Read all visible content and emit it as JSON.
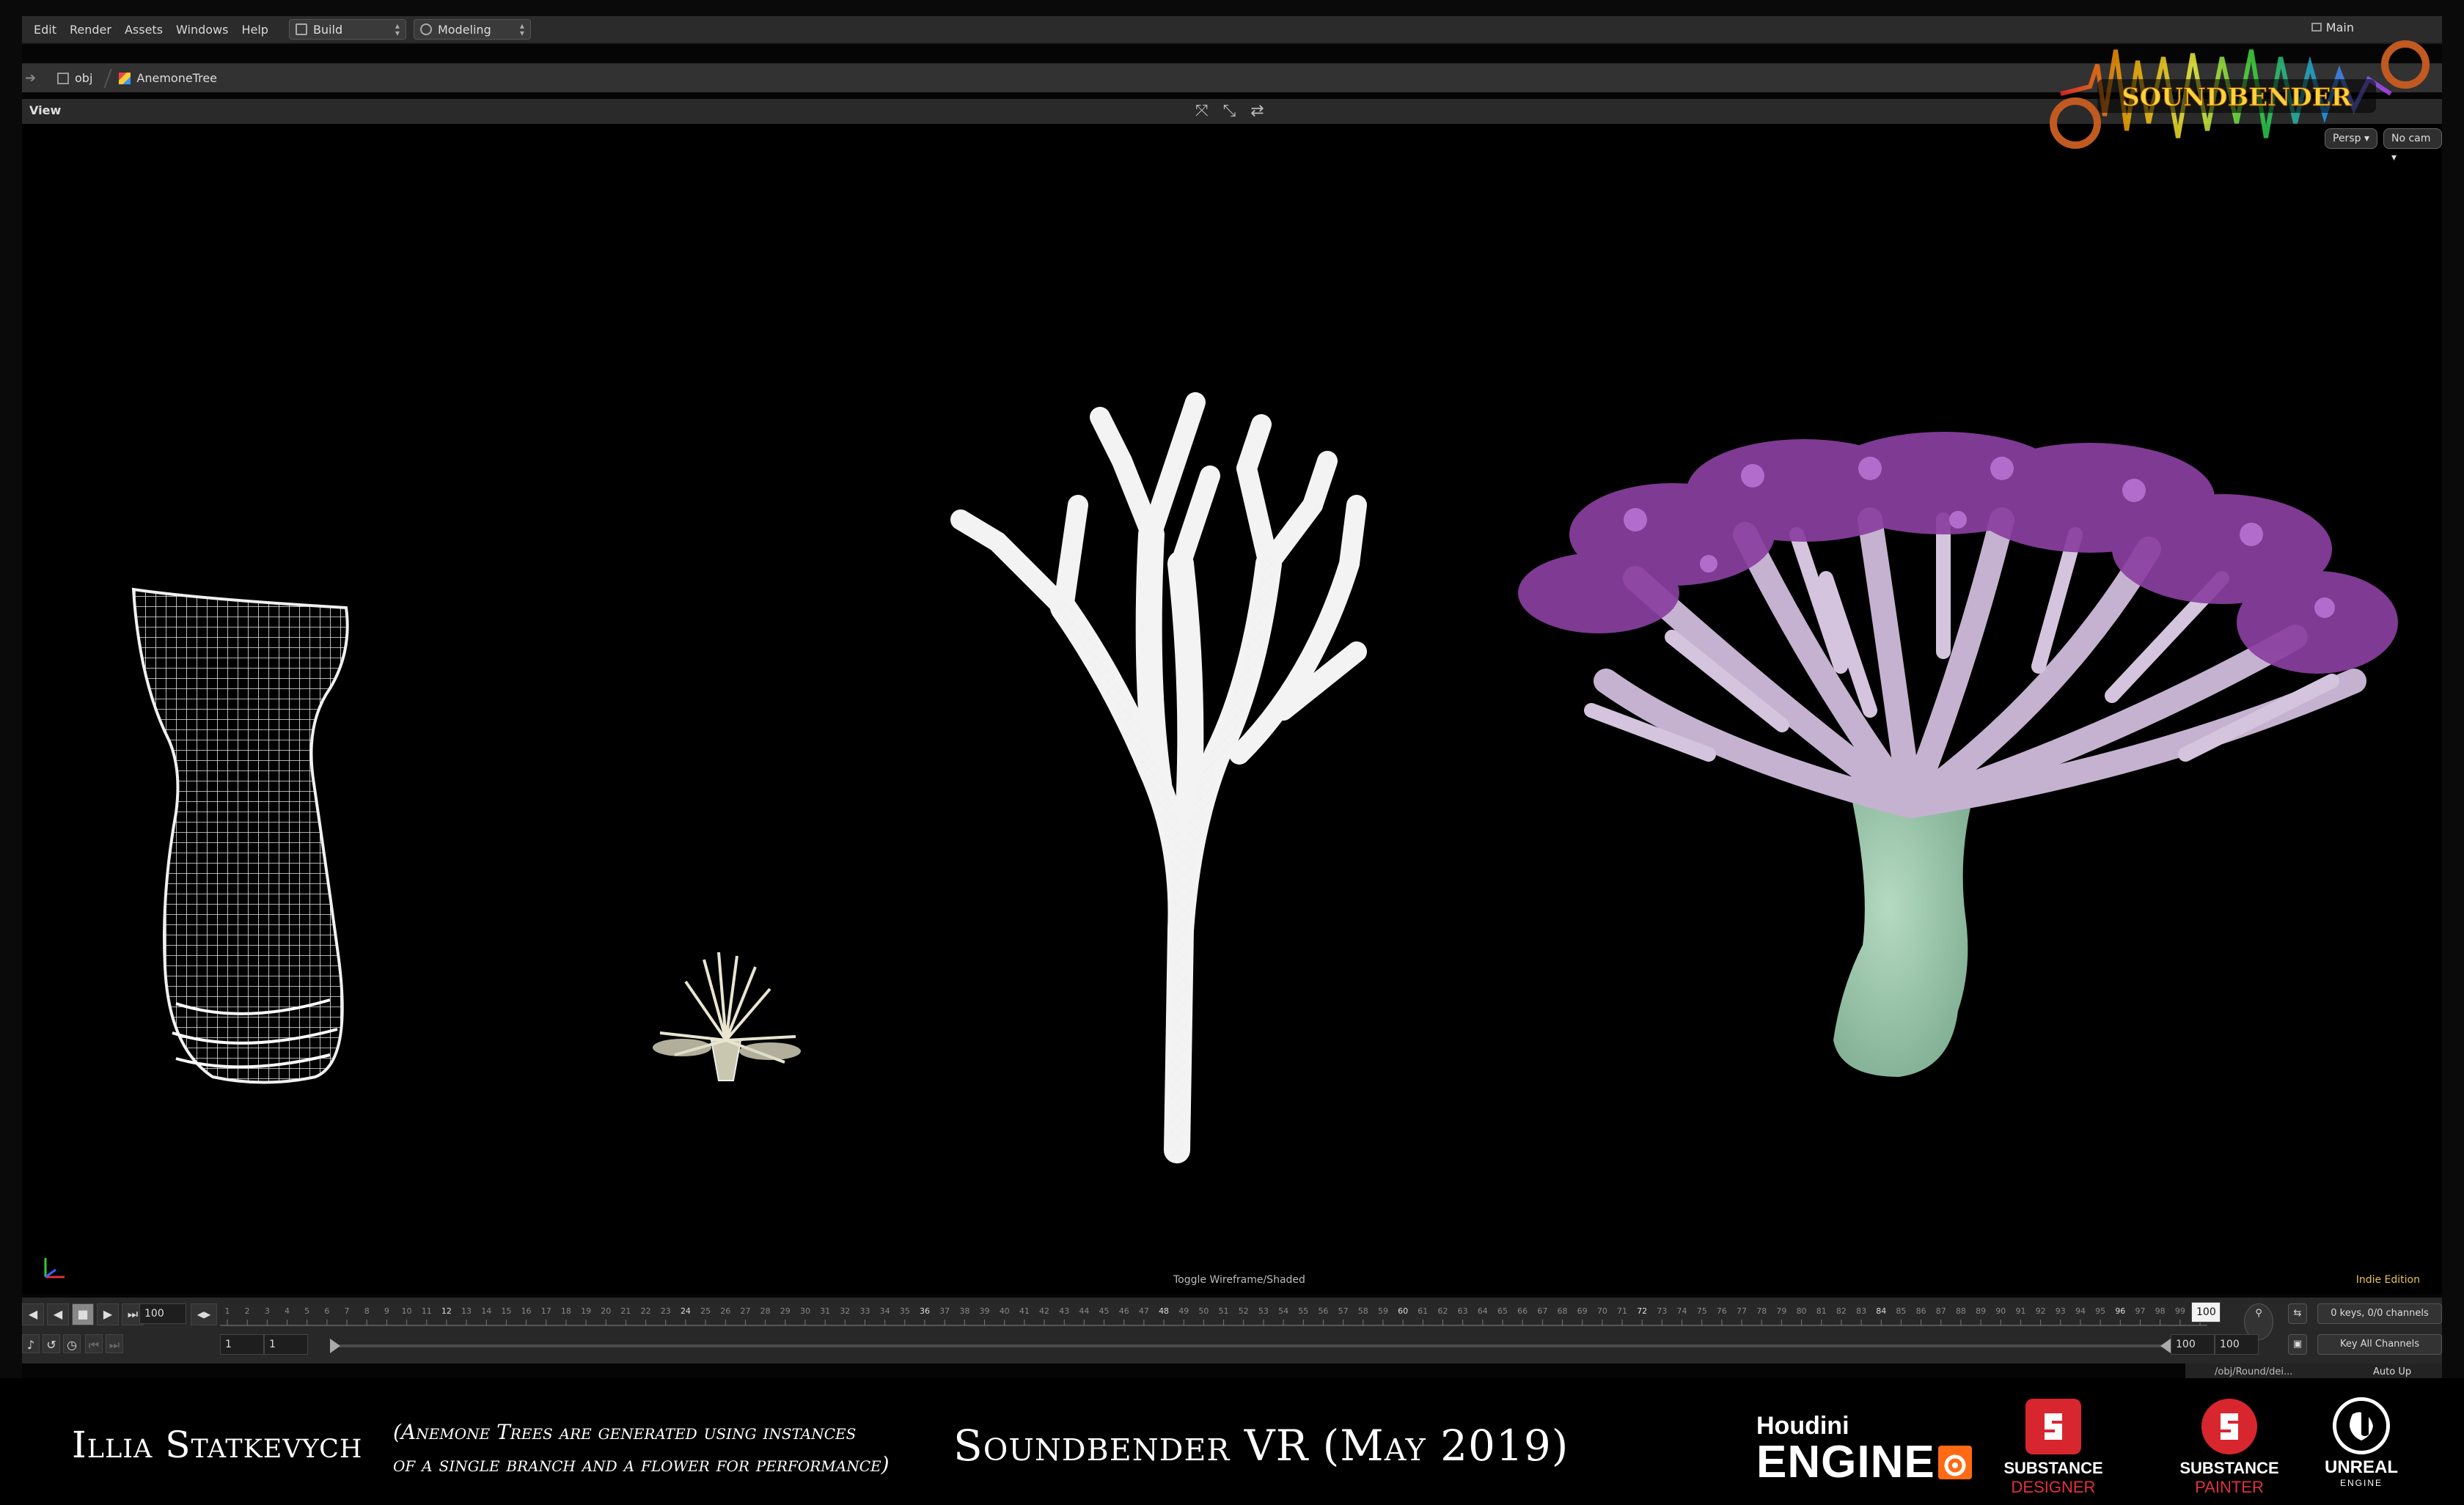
{
  "menubar": {
    "items": [
      "Edit",
      "Render",
      "Assets",
      "Windows",
      "Help"
    ],
    "desk_selector": "Build",
    "context_selector": "Modeling",
    "desktop_label": "Main"
  },
  "pathbar": {
    "root": "obj",
    "node": "AnemoneTree"
  },
  "viewport": {
    "pane_label": "View",
    "camera_persp": "Persp",
    "camera_cam": "No cam",
    "toggle_label": "Toggle Wireframe/Shaded",
    "edition": "Indie Edition"
  },
  "logo": {
    "text": "SOUNDBENDER"
  },
  "timeline": {
    "current_frame": "100",
    "start_frame": "1",
    "start_frame_2": "1",
    "end_frame": "100",
    "end_frame_2": "100",
    "marker": "100",
    "keys_status": "0 keys, 0/0 channels",
    "key_all_label": "Key All Channels",
    "auto_update": "Auto Up",
    "status_path": "/obj/Round/dei...",
    "ruler_max": 100
  },
  "footer": {
    "author": "Illia Statkevych",
    "note_line1": "(Anemone Trees are generated using instances",
    "note_line2": "of a single branch and  a flower for performance)",
    "title": "Soundbender  VR (May 2019)",
    "houdini_line1": "Houdini",
    "houdini_line2": "ENGINE",
    "designer_l1": "SUBSTANCE",
    "designer_l2": "DESIGNER",
    "painter_l1": "SUBSTANCE",
    "painter_l2": "PAINTER",
    "unreal_l1": "UNREAL",
    "unreal_l2": "ENGINE"
  },
  "colors": {
    "accent_orange": "#ff6a13",
    "substance_red": "#d8262f",
    "trunk_green": "#9fc8ae",
    "branch_lilac": "#c9b4d4",
    "flower_purple": "#8a3fa0",
    "edition_yellow": "#e8c34a"
  },
  "icons": {
    "desk": "grid-icon",
    "context": "target-icon",
    "obj": "object-icon",
    "node": "color-node-icon",
    "handle": "handle-icon",
    "pose": "pose-icon",
    "axis": "axis-icon"
  }
}
